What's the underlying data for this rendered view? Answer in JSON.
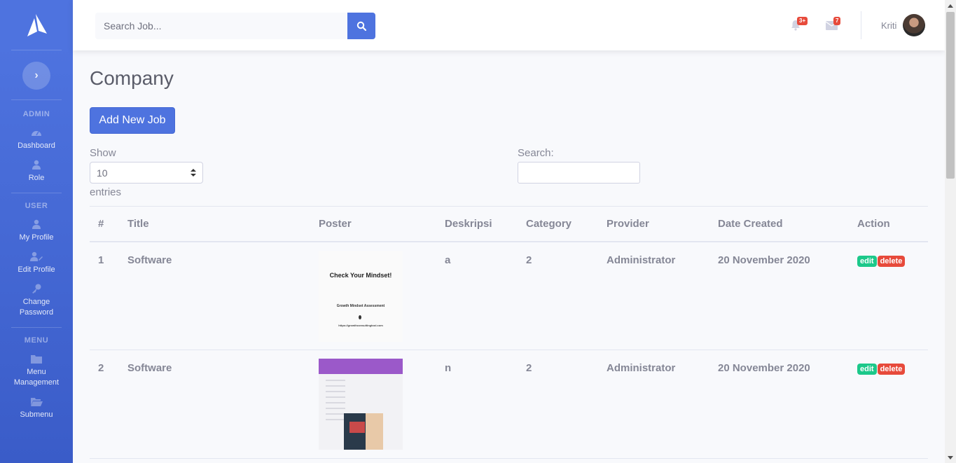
{
  "sidebar": {
    "sections": [
      {
        "heading": "ADMIN",
        "items": [
          {
            "label": "Dashboard",
            "icon": "dashboard-icon"
          },
          {
            "label": "Role",
            "icon": "user-icon"
          }
        ]
      },
      {
        "heading": "USER",
        "items": [
          {
            "label": "My Profile",
            "icon": "user-icon"
          },
          {
            "label": "Edit Profile",
            "icon": "user-edit-icon"
          },
          {
            "label": "Change Password",
            "icon": "key-icon"
          }
        ]
      },
      {
        "heading": "MENU",
        "items": [
          {
            "label": "Menu Management",
            "icon": "folder-icon"
          },
          {
            "label": "Submenu",
            "icon": "folder-open-icon"
          }
        ]
      }
    ]
  },
  "topbar": {
    "search_placeholder": "Search Job...",
    "alerts_badge": "3+",
    "messages_badge": "7",
    "user_name": "Kriti"
  },
  "page": {
    "title": "Company",
    "add_button": "Add New Job",
    "show_label": "Show",
    "entries_value": "10",
    "entries_label": "entries",
    "search_label": "Search:"
  },
  "table": {
    "headers": [
      "#",
      "Title",
      "Poster",
      "Deskripsi",
      "Category",
      "Provider",
      "Date Created",
      "Action"
    ],
    "rows": [
      {
        "num": "1",
        "title": "Software",
        "poster": "Check Your Mindset!",
        "poster_sub": "Growth Mindset Assessment",
        "poster_url": "https://growthconsultingtool.com",
        "deskripsi": "a",
        "category": "2",
        "provider": "Administrator",
        "date": "20 November 2020",
        "edit": "edit",
        "delete": "delete"
      },
      {
        "num": "2",
        "title": "Software",
        "poster": "",
        "deskripsi": "n",
        "category": "2",
        "provider": "Administrator",
        "date": "20 November 2020",
        "edit": "edit",
        "delete": "delete"
      }
    ]
  },
  "colors": {
    "primary": "#4e73df",
    "success": "#1cc88a",
    "danger": "#e74a3b",
    "text": "#858796"
  }
}
